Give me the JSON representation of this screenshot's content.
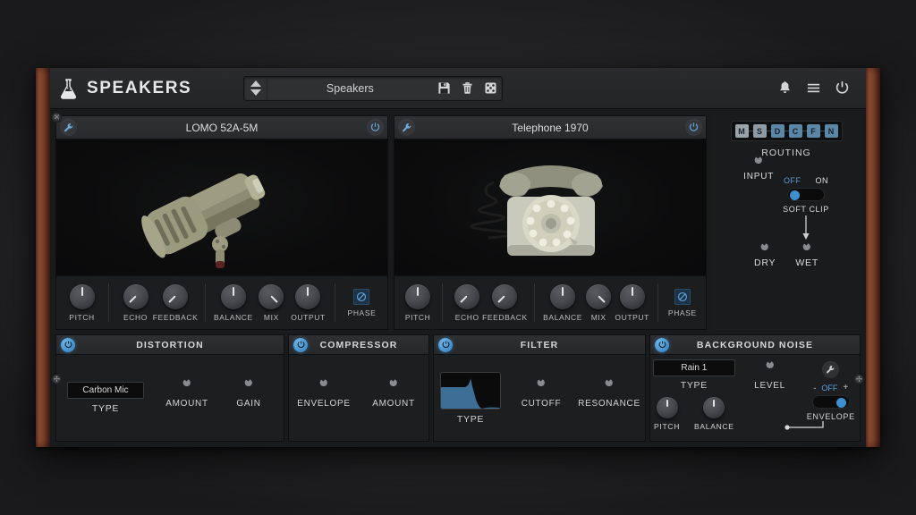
{
  "window": {
    "brand_title": "SPEAKERS",
    "logo_icon": "flask-icon"
  },
  "preset_bar": {
    "preset_name": "Speakers",
    "spinner_up_icon": "triangle-up-icon",
    "spinner_down_icon": "triangle-down-icon",
    "save_icon": "floppy-save-icon",
    "delete_icon": "trash-icon",
    "random_icon": "dice-icon"
  },
  "titlebar_right": {
    "notifications_icon": "bell-icon",
    "menu_icon": "hamburger-menu-icon",
    "power_icon": "power-icon"
  },
  "modules": [
    {
      "title": "LOMO 52A-5M",
      "settings_icon": "wrench-icon",
      "power_icon": "power-icon",
      "image": "vintage-ribbon-microphone",
      "knobs": [
        {
          "label": "PITCH",
          "angle": 0
        },
        {
          "label": "ECHO",
          "angle": -135
        },
        {
          "label": "FEEDBACK",
          "angle": -135
        },
        {
          "label": "BALANCE",
          "angle": 0
        },
        {
          "label": "MIX",
          "angle": 135
        },
        {
          "label": "OUTPUT",
          "angle": 0
        }
      ],
      "phase": {
        "label": "PHASE",
        "icon": "phase-invert-icon"
      }
    },
    {
      "title": "Telephone 1970",
      "settings_icon": "wrench-icon",
      "power_icon": "power-icon",
      "image": "rotary-dial-telephone",
      "knobs": [
        {
          "label": "PITCH",
          "angle": 0
        },
        {
          "label": "ECHO",
          "angle": -135
        },
        {
          "label": "FEEDBACK",
          "angle": -135
        },
        {
          "label": "BALANCE",
          "angle": 0
        },
        {
          "label": "MIX",
          "angle": 135
        },
        {
          "label": "OUTPUT",
          "angle": 0
        }
      ],
      "phase": {
        "label": "PHASE",
        "icon": "phase-invert-icon"
      }
    }
  ],
  "routing": {
    "label": "ROUTING",
    "stages": [
      {
        "letter": "M",
        "color": "#9aa3a8"
      },
      {
        "letter": "S",
        "color": "#8f9aa2"
      },
      {
        "letter": "D",
        "color": "#5c86a6"
      },
      {
        "letter": "C",
        "color": "#5c86a6"
      },
      {
        "letter": "F",
        "color": "#5c86a6"
      },
      {
        "letter": "N",
        "color": "#5c86a6"
      }
    ],
    "input": {
      "label": "INPUT",
      "angle": 0
    },
    "soft_clip": {
      "label": "SOFT CLIP",
      "off_text": "OFF",
      "on_text": "ON",
      "state": "OFF",
      "accent": "#3d8fcd"
    },
    "dry": {
      "label": "DRY",
      "angle": 0
    },
    "wet": {
      "label": "WET",
      "angle": 0
    }
  },
  "effects": {
    "distortion": {
      "title": "DISTORTION",
      "power_icon": "power-icon",
      "type_value": "Carbon Mic",
      "type_label": "TYPE",
      "knobs": [
        {
          "label": "AMOUNT",
          "angle": 0
        },
        {
          "label": "GAIN",
          "angle": 0
        }
      ]
    },
    "compressor": {
      "title": "COMPRESSOR",
      "power_icon": "power-icon",
      "knobs": [
        {
          "label": "ENVELOPE",
          "angle": 0
        },
        {
          "label": "AMOUNT",
          "angle": 0
        }
      ]
    },
    "filter": {
      "title": "FILTER",
      "power_icon": "power-icon",
      "type_label": "TYPE",
      "type_shape": "lowpass-curve",
      "curve_color": "#3d6e96",
      "knobs": [
        {
          "label": "CUTOFF",
          "angle": 0
        },
        {
          "label": "RESONANCE",
          "angle": 0
        }
      ]
    },
    "background_noise": {
      "title": "BACKGROUND NOISE",
      "power_icon": "power-icon",
      "type_value": "Rain 1",
      "type_label": "TYPE",
      "small_knobs": [
        {
          "label": "PITCH",
          "angle": 0
        },
        {
          "label": "BALANCE",
          "angle": 0
        }
      ],
      "level": {
        "label": "LEVEL",
        "angle": 0
      },
      "settings_icon": "wrench-icon",
      "envelope": {
        "label": "ENVELOPE",
        "minus": "-",
        "plus": "+",
        "state": "OFF",
        "accent": "#3d8fcd"
      }
    }
  }
}
